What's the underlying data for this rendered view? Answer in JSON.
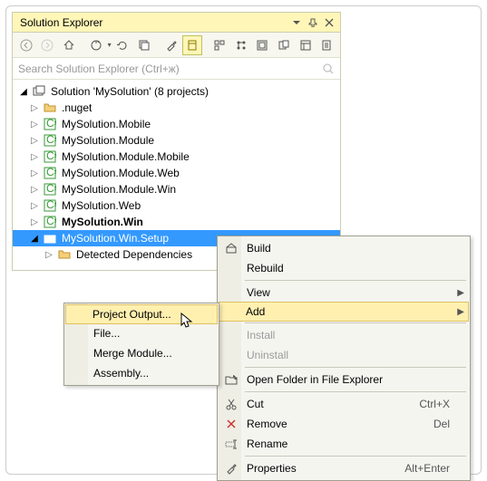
{
  "window": {
    "title": "Solution Explorer",
    "search_placeholder": "Search Solution Explorer (Ctrl+ж)"
  },
  "tree": {
    "root": "Solution 'MySolution' (8 projects)",
    "items": [
      ".nuget",
      "MySolution.Mobile",
      "MySolution.Module",
      "MySolution.Module.Mobile",
      "MySolution.Module.Web",
      "MySolution.Module.Win",
      "MySolution.Web",
      "MySolution.Win",
      "MySolution.Win.Setup"
    ],
    "detected": "Detected Dependencies"
  },
  "context": {
    "build": "Build",
    "rebuild": "Rebuild",
    "view": "View",
    "add": "Add",
    "install": "Install",
    "uninstall": "Uninstall",
    "open_folder": "Open Folder in File Explorer",
    "cut": "Cut",
    "cut_key": "Ctrl+X",
    "remove": "Remove",
    "remove_key": "Del",
    "rename": "Rename",
    "properties": "Properties",
    "properties_key": "Alt+Enter"
  },
  "submenu": {
    "project_output": "Project Output...",
    "file": "File...",
    "merge_module": "Merge Module...",
    "assembly": "Assembly..."
  }
}
